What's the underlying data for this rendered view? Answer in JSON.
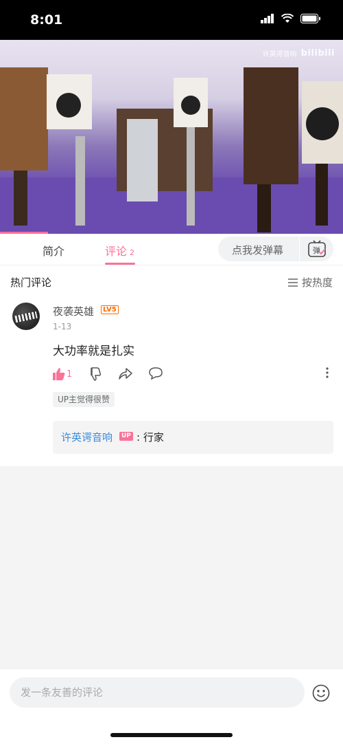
{
  "status_bar": {
    "time": "8:01"
  },
  "video": {
    "watermark_text": "许英谔音响",
    "watermark_logo": "bilibili",
    "progress": 0.14
  },
  "tabs": [
    {
      "label": "简介"
    },
    {
      "label": "评论",
      "count": "2",
      "active": true
    }
  ],
  "danmaku": {
    "placeholder": "点我发弹幕",
    "button_glyph": "弹"
  },
  "section": {
    "title": "热门评论",
    "sort_label": "按热度"
  },
  "comment": {
    "username": "夜袭英雄",
    "level": "LV5",
    "date": "1-13",
    "text": "大功率就是扎实",
    "likes": "1",
    "up_tag": "UP主觉得很赞",
    "reply": {
      "author": "许英谔音响",
      "badge": "UP",
      "text": ": 行家"
    }
  },
  "composer": {
    "placeholder": "发一条友善的评论"
  },
  "colors": {
    "accent": "#fb7299",
    "link": "#3a8bd8",
    "level": "#ff6c00"
  }
}
